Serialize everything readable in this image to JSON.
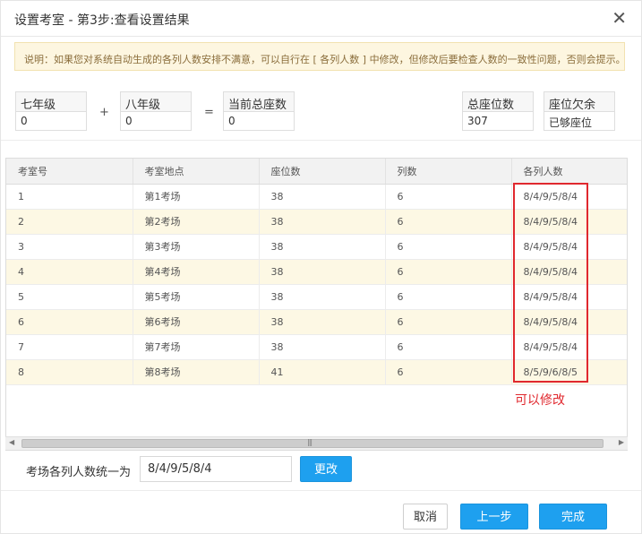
{
  "dialog": {
    "title": "设置考室 - 第3步:查看设置结果",
    "close_icon": "close-icon"
  },
  "notice": {
    "text": "说明：如果您对系统自动生成的各列人数安排不满意，可以自行在 [ 各列人数 ] 中修改，但修改后要检查人数的一致性问题，否则会提示。"
  },
  "stats": {
    "grade7": {
      "label": "七年级",
      "value": "0"
    },
    "plus": "+",
    "grade8": {
      "label": "八年级",
      "value": "0"
    },
    "equals": "=",
    "current_total": {
      "label": "当前总座数",
      "value": "0"
    },
    "total_seats": {
      "label": "总座位数",
      "value": "307"
    },
    "seat_status": {
      "label": "座位欠余",
      "value": "已够座位"
    }
  },
  "table": {
    "headers": [
      "考室号",
      "考室地点",
      "座位数",
      "列数",
      "各列人数"
    ],
    "rows": [
      [
        "1",
        "第1考场",
        "38",
        "6",
        "8/4/9/5/8/4"
      ],
      [
        "2",
        "第2考场",
        "38",
        "6",
        "8/4/9/5/8/4"
      ],
      [
        "3",
        "第3考场",
        "38",
        "6",
        "8/4/9/5/8/4"
      ],
      [
        "4",
        "第4考场",
        "38",
        "6",
        "8/4/9/5/8/4"
      ],
      [
        "5",
        "第5考场",
        "38",
        "6",
        "8/4/9/5/8/4"
      ],
      [
        "6",
        "第6考场",
        "38",
        "6",
        "8/4/9/5/8/4"
      ],
      [
        "7",
        "第7考场",
        "38",
        "6",
        "8/4/9/5/8/4"
      ],
      [
        "8",
        "第8考场",
        "41",
        "6",
        "8/5/9/6/8/5"
      ]
    ]
  },
  "annotation": {
    "text": "可以修改",
    "color": "#e0282e"
  },
  "unify": {
    "label": "考场各列人数统一为",
    "value": "8/4/9/5/8/4",
    "button": "更改"
  },
  "footer": {
    "cancel": "取消",
    "prev": "上一步",
    "finish": "完成"
  },
  "colors": {
    "accent": "#1ea0ef",
    "notice_bg": "#fdf6e0",
    "row_alt": "#fdf8e4"
  }
}
